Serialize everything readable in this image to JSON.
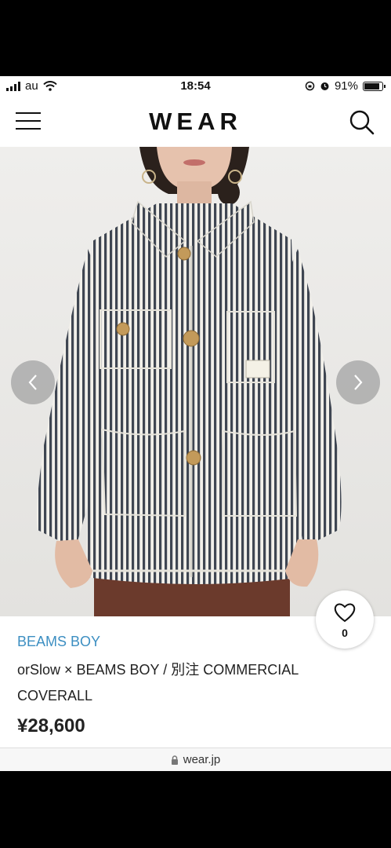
{
  "status_bar": {
    "carrier": "au",
    "time": "18:54",
    "battery": "91%",
    "battery_level": 0.91,
    "icons": [
      "signal-icon",
      "wifi-icon",
      "orientation-lock-icon",
      "alarm-icon",
      "battery-icon"
    ]
  },
  "header": {
    "logo": "WEAR",
    "icons": [
      "hamburger-menu-icon",
      "search-icon"
    ]
  },
  "product": {
    "brand": "BEAMS BOY",
    "title": "orSlow × BEAMS BOY / 別注 COMMERCIAL COVERALL",
    "price": "¥28,600",
    "favorite_count": "0",
    "image_description_icons": [
      "chevron-left-icon",
      "chevron-right-icon",
      "heart-icon"
    ]
  },
  "browser": {
    "url": "wear.jp"
  },
  "colors": {
    "brand_link": "#3d8fc2",
    "text": "#222222",
    "stripe_dark": "#3f4652",
    "stripe_light": "#f2f0ea"
  }
}
